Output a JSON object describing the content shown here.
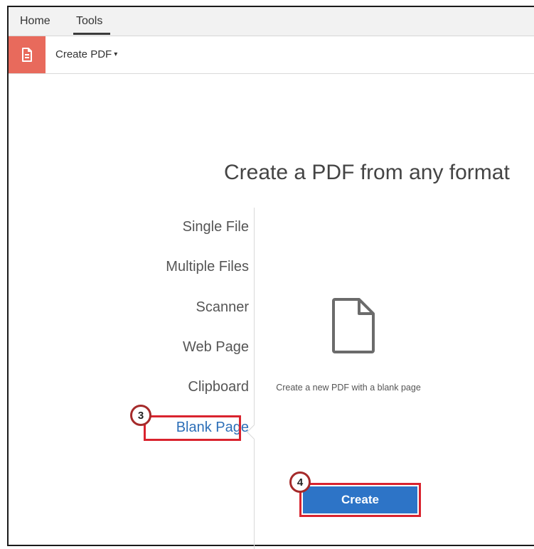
{
  "menubar": {
    "items": [
      {
        "label": "Home"
      },
      {
        "label": "Tools"
      }
    ],
    "active": "Tools"
  },
  "toolbar": {
    "tool_icon": "create-pdf-icon",
    "tool_label": "Create PDF",
    "caret": "▾"
  },
  "main": {
    "heading": "Create a PDF from any format",
    "options": [
      {
        "label": "Single File"
      },
      {
        "label": "Multiple Files"
      },
      {
        "label": "Scanner"
      },
      {
        "label": "Web Page"
      },
      {
        "label": "Clipboard"
      },
      {
        "label": "Blank Page"
      }
    ],
    "selected_option": "Blank Page",
    "detail_icon": "blank-page-icon",
    "detail_text": "Create a new PDF with a blank page",
    "create_button": "Create"
  },
  "annotations": {
    "step_3": "3",
    "step_4": "4"
  },
  "colors": {
    "tool_icon_bg": "#e86a5c",
    "active_link": "#2d6fb8",
    "button": "#2d74c7",
    "highlight": "#d9232e"
  }
}
